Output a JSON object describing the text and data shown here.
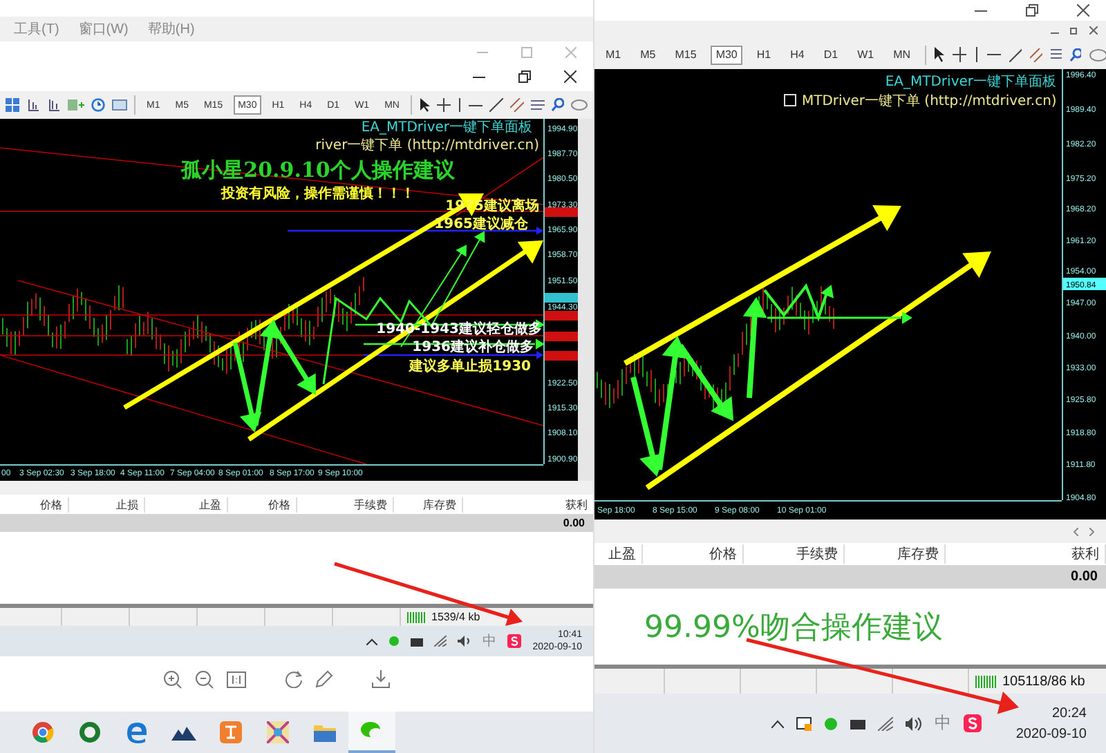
{
  "left_window": {
    "menu": [
      {
        "label": "工具(T)"
      },
      {
        "label": "窗口(W)"
      },
      {
        "label": "帮助(H)"
      }
    ],
    "toolbar": {
      "timeframes": [
        {
          "label": "M1",
          "selected": false
        },
        {
          "label": "M5",
          "selected": false
        },
        {
          "label": "M15",
          "selected": false
        },
        {
          "label": "M30",
          "selected": true
        },
        {
          "label": "H1",
          "selected": false
        },
        {
          "label": "H4",
          "selected": false
        },
        {
          "label": "D1",
          "selected": false
        },
        {
          "label": "W1",
          "selected": false
        },
        {
          "label": "MN",
          "selected": false
        }
      ]
    },
    "chart": {
      "info_label": "EA_MTDriver一键下单面板",
      "link_text": "river一键下单 (http://mtdriver.cn)",
      "title": "孤小星20.9.10个人操作建议",
      "warning": "投资有风险，操作需谨慎！！！",
      "notes": [
        {
          "text": "1975建议离场"
        },
        {
          "text": "1965建议减仓"
        },
        {
          "text": "1940-1943建议轻仓做多"
        },
        {
          "text": "1936建议补仓做多"
        },
        {
          "text": "建议多单止损1930"
        }
      ],
      "price_axis": [
        "1994.90",
        "1987.70",
        "1980.50",
        "1973.30",
        "1965.90",
        "1958.70",
        "1951.50",
        "1944.30",
        "1922.50",
        "1915.30",
        "1908.10",
        "1900.90"
      ],
      "time_axis": [
        "00",
        "3 Sep 02:30",
        "3 Sep 18:00",
        "4 Sep 11:00",
        "7 Sep 04:00",
        "8 Sep 01:00",
        "8 Sep 17:00",
        "9 Sep 10:00"
      ]
    },
    "table": {
      "columns": [
        "价格",
        "止损",
        "止盈",
        "价格",
        "手续费",
        "库存费",
        "获利"
      ],
      "total": "0.00"
    },
    "status_bar": {
      "memory": "1539/4 kb"
    },
    "taskbar": {
      "ime": "中",
      "time": "10:41",
      "date": "2020-09-10"
    }
  },
  "right_window": {
    "toolbar": {
      "timeframes": [
        {
          "label": "M1",
          "selected": false
        },
        {
          "label": "M5",
          "selected": false
        },
        {
          "label": "M15",
          "selected": false
        },
        {
          "label": "M30",
          "selected": true
        },
        {
          "label": "H1",
          "selected": false
        },
        {
          "label": "H4",
          "selected": false
        },
        {
          "label": "D1",
          "selected": false
        },
        {
          "label": "W1",
          "selected": false
        },
        {
          "label": "MN",
          "selected": false
        }
      ]
    },
    "chart": {
      "info_label": "EA_MTDriver一键下单面板",
      "link_text": "MTDriver一键下单 (http://mtdriver.cn)",
      "price_badge": "1950.84",
      "price_axis": [
        "1996.40",
        "1989.40",
        "1982.20",
        "1975.20",
        "1968.20",
        "1961.20",
        "1954.00",
        "1947.00",
        "1940.00",
        "1933.00",
        "1925.80",
        "1918.80",
        "1911.80",
        "1904.80"
      ],
      "time_axis": [
        "Sep 18:00",
        "8 Sep 15:00",
        "9 Sep 08:00",
        "10 Sep 01:00"
      ]
    },
    "table": {
      "columns": [
        "止盈",
        "价格",
        "手续费",
        "库存费",
        "获利"
      ],
      "total": "0.00"
    },
    "note": "99.99%吻合操作建议",
    "status_bar": {
      "memory": "105118/86 kb"
    },
    "taskbar": {
      "ime": "中",
      "time": "20:24",
      "date": "2020-09-10"
    }
  }
}
